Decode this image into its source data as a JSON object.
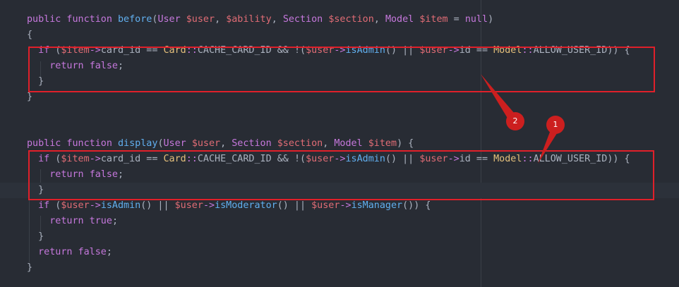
{
  "code_lines": [
    [
      {
        "t": "public function ",
        "c": "kw"
      },
      {
        "t": "before",
        "c": "fn"
      },
      {
        "t": "(",
        "c": "plain"
      },
      {
        "t": "User ",
        "c": "kw"
      },
      {
        "t": "$user",
        "c": "var"
      },
      {
        "t": ", ",
        "c": "plain"
      },
      {
        "t": "$ability",
        "c": "var"
      },
      {
        "t": ", ",
        "c": "plain"
      },
      {
        "t": "Section ",
        "c": "kw"
      },
      {
        "t": "$section",
        "c": "var"
      },
      {
        "t": ", ",
        "c": "plain"
      },
      {
        "t": "Model ",
        "c": "kw"
      },
      {
        "t": "$item",
        "c": "var"
      },
      {
        "t": " = ",
        "c": "plain"
      },
      {
        "t": "null",
        "c": "kw"
      },
      {
        "t": ")",
        "c": "plain"
      }
    ],
    [
      {
        "t": "{",
        "c": "plain"
      }
    ],
    [
      {
        "t": "  ",
        "c": "plain"
      },
      {
        "t": "if",
        "c": "kw"
      },
      {
        "t": " (",
        "c": "plain"
      },
      {
        "t": "$item",
        "c": "var"
      },
      {
        "t": "->",
        "c": "kw"
      },
      {
        "t": "card_id",
        "c": "plain"
      },
      {
        "t": " == ",
        "c": "plain"
      },
      {
        "t": "Card",
        "c": "type"
      },
      {
        "t": "::",
        "c": "kw"
      },
      {
        "t": "CACHE_CARD_ID",
        "c": "plain"
      },
      {
        "t": " && ",
        "c": "plain"
      },
      {
        "t": "!(",
        "c": "plain"
      },
      {
        "t": "$user",
        "c": "var"
      },
      {
        "t": "->",
        "c": "kw"
      },
      {
        "t": "isAdmin",
        "c": "fn"
      },
      {
        "t": "()",
        "c": "plain"
      },
      {
        "t": " || ",
        "c": "plain"
      },
      {
        "t": "$user",
        "c": "var"
      },
      {
        "t": "->",
        "c": "kw"
      },
      {
        "t": "id",
        "c": "plain"
      },
      {
        "t": " == ",
        "c": "plain"
      },
      {
        "t": "Model",
        "c": "type"
      },
      {
        "t": "::",
        "c": "kw"
      },
      {
        "t": "ALLOW_USER_ID",
        "c": "plain"
      },
      {
        "t": ")) {",
        "c": "plain"
      }
    ],
    [
      {
        "t": "    ",
        "c": "plain"
      },
      {
        "t": "return",
        "c": "kw"
      },
      {
        "t": " ",
        "c": "plain"
      },
      {
        "t": "false",
        "c": "kw"
      },
      {
        "t": ";",
        "c": "plain"
      }
    ],
    [
      {
        "t": "  }",
        "c": "plain"
      }
    ],
    [
      {
        "t": "}",
        "c": "plain"
      }
    ],
    [],
    [],
    [
      {
        "t": "public function ",
        "c": "kw"
      },
      {
        "t": "display",
        "c": "fn"
      },
      {
        "t": "(",
        "c": "plain"
      },
      {
        "t": "User ",
        "c": "kw"
      },
      {
        "t": "$user",
        "c": "var"
      },
      {
        "t": ", ",
        "c": "plain"
      },
      {
        "t": "Section ",
        "c": "kw"
      },
      {
        "t": "$section",
        "c": "var"
      },
      {
        "t": ", ",
        "c": "plain"
      },
      {
        "t": "Model ",
        "c": "kw"
      },
      {
        "t": "$item",
        "c": "var"
      },
      {
        "t": ") {",
        "c": "plain"
      }
    ],
    [
      {
        "t": "  ",
        "c": "plain"
      },
      {
        "t": "if",
        "c": "kw"
      },
      {
        "t": " (",
        "c": "plain"
      },
      {
        "t": "$item",
        "c": "var"
      },
      {
        "t": "->",
        "c": "kw"
      },
      {
        "t": "card_id",
        "c": "plain"
      },
      {
        "t": " == ",
        "c": "plain"
      },
      {
        "t": "Card",
        "c": "type"
      },
      {
        "t": "::",
        "c": "kw"
      },
      {
        "t": "CACHE_CARD_ID",
        "c": "plain"
      },
      {
        "t": " && ",
        "c": "plain"
      },
      {
        "t": "!(",
        "c": "plain"
      },
      {
        "t": "$user",
        "c": "var"
      },
      {
        "t": "->",
        "c": "kw"
      },
      {
        "t": "isAdmin",
        "c": "fn"
      },
      {
        "t": "()",
        "c": "plain"
      },
      {
        "t": " || ",
        "c": "plain"
      },
      {
        "t": "$user",
        "c": "var"
      },
      {
        "t": "->",
        "c": "kw"
      },
      {
        "t": "id",
        "c": "plain"
      },
      {
        "t": " == ",
        "c": "plain"
      },
      {
        "t": "Model",
        "c": "type"
      },
      {
        "t": "::",
        "c": "kw"
      },
      {
        "t": "ALLOW_USER_ID",
        "c": "plain"
      },
      {
        "t": ")) {",
        "c": "plain"
      }
    ],
    [
      {
        "t": "    ",
        "c": "plain"
      },
      {
        "t": "return",
        "c": "kw"
      },
      {
        "t": " ",
        "c": "plain"
      },
      {
        "t": "false",
        "c": "kw"
      },
      {
        "t": ";",
        "c": "plain"
      }
    ],
    [
      {
        "t": "  }",
        "c": "plain"
      }
    ],
    [
      {
        "t": "  ",
        "c": "plain"
      },
      {
        "t": "if",
        "c": "kw"
      },
      {
        "t": " (",
        "c": "plain"
      },
      {
        "t": "$user",
        "c": "var"
      },
      {
        "t": "->",
        "c": "kw"
      },
      {
        "t": "isAdmin",
        "c": "fn"
      },
      {
        "t": "()",
        "c": "plain"
      },
      {
        "t": " || ",
        "c": "plain"
      },
      {
        "t": "$user",
        "c": "var"
      },
      {
        "t": "->",
        "c": "kw"
      },
      {
        "t": "isModerator",
        "c": "fn"
      },
      {
        "t": "()",
        "c": "plain"
      },
      {
        "t": " || ",
        "c": "plain"
      },
      {
        "t": "$user",
        "c": "var"
      },
      {
        "t": "->",
        "c": "kw"
      },
      {
        "t": "isManager",
        "c": "fn"
      },
      {
        "t": "()) {",
        "c": "plain"
      }
    ],
    [
      {
        "t": "    ",
        "c": "plain"
      },
      {
        "t": "return",
        "c": "kw"
      },
      {
        "t": " ",
        "c": "plain"
      },
      {
        "t": "true",
        "c": "kw"
      },
      {
        "t": ";",
        "c": "plain"
      }
    ],
    [
      {
        "t": "  }",
        "c": "plain"
      }
    ],
    [
      {
        "t": "  ",
        "c": "plain"
      },
      {
        "t": "return",
        "c": "kw"
      },
      {
        "t": " ",
        "c": "plain"
      },
      {
        "t": "false",
        "c": "kw"
      },
      {
        "t": ";",
        "c": "plain"
      }
    ],
    [
      {
        "t": "}",
        "c": "plain"
      }
    ]
  ],
  "highlighted_line_index": 11,
  "annotations": {
    "badge_1": "1",
    "badge_2": "2"
  },
  "colors": {
    "background": "#282c34",
    "keyword": "#c678dd",
    "function": "#61afef",
    "variable": "#e06c75",
    "type": "#e5c07b",
    "text": "#abb2bf",
    "annotation_red": "#e0202a"
  }
}
